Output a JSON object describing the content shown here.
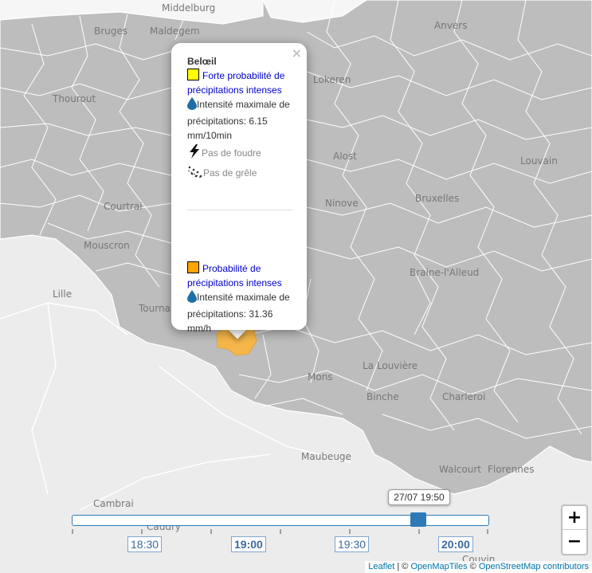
{
  "places": [
    {
      "name": "Middelburg"
    },
    {
      "name": "Bruges"
    },
    {
      "name": "Maldegem"
    },
    {
      "name": "Anvers"
    },
    {
      "name": "Thourout"
    },
    {
      "name": "Lokeren"
    },
    {
      "name": "Alost"
    },
    {
      "name": "Louvain"
    },
    {
      "name": "Bruxelles"
    },
    {
      "name": "Ninove"
    },
    {
      "name": "Courtrai"
    },
    {
      "name": "Mouscron"
    },
    {
      "name": "Braine-l'Alleud"
    },
    {
      "name": "Lille"
    },
    {
      "name": "Tournai"
    },
    {
      "name": "Mons"
    },
    {
      "name": "La Louvière"
    },
    {
      "name": "Binche"
    },
    {
      "name": "Charleroi"
    },
    {
      "name": "Maubeuge"
    },
    {
      "name": "Walcourt"
    },
    {
      "name": "Florennes"
    },
    {
      "name": "Cambrai"
    },
    {
      "name": "Caudry"
    },
    {
      "name": "Couvin"
    }
  ],
  "popup": {
    "title": "Belœil",
    "close_label": "×",
    "alerts": [
      {
        "color": "#ffff00",
        "level_text": "Forte probabilité de précipitations intenses",
        "intensity_text": "Intensité maximale de précipitations: 6.15 mm/10min",
        "lightning_text": "Pas de foudre",
        "hail_text": "Pas de grêle"
      },
      {
        "color": "#ffa500",
        "level_text": "Probabilité de précipitations intenses",
        "intensity_text": "Intensité maximale de précipitations: 31.36 mm/h"
      }
    ]
  },
  "timeline": {
    "current_time": "27/07 19:50",
    "current_position": 0.83,
    "labels": [
      {
        "text": "18:30",
        "bold": false
      },
      {
        "text": "19:00",
        "bold": true
      },
      {
        "text": "19:30",
        "bold": false
      },
      {
        "text": "20:00",
        "bold": true
      }
    ]
  },
  "zoom": {
    "in_label": "+",
    "out_label": "−"
  },
  "attribution": {
    "leaflet": "Leaflet",
    "sep1": " | © ",
    "openmaptiles": "OpenMapTiles",
    "sep2": " © ",
    "osm": "OpenStreetMap contributors"
  },
  "colors": {
    "belgium_fill": "#bdbdbd",
    "region_border": "#ffffff",
    "outside_fill": "#eeeeee",
    "sea_fill": "#f8f8f8",
    "alert_region": "#f5b74a",
    "accent": "#2c7bb6"
  }
}
